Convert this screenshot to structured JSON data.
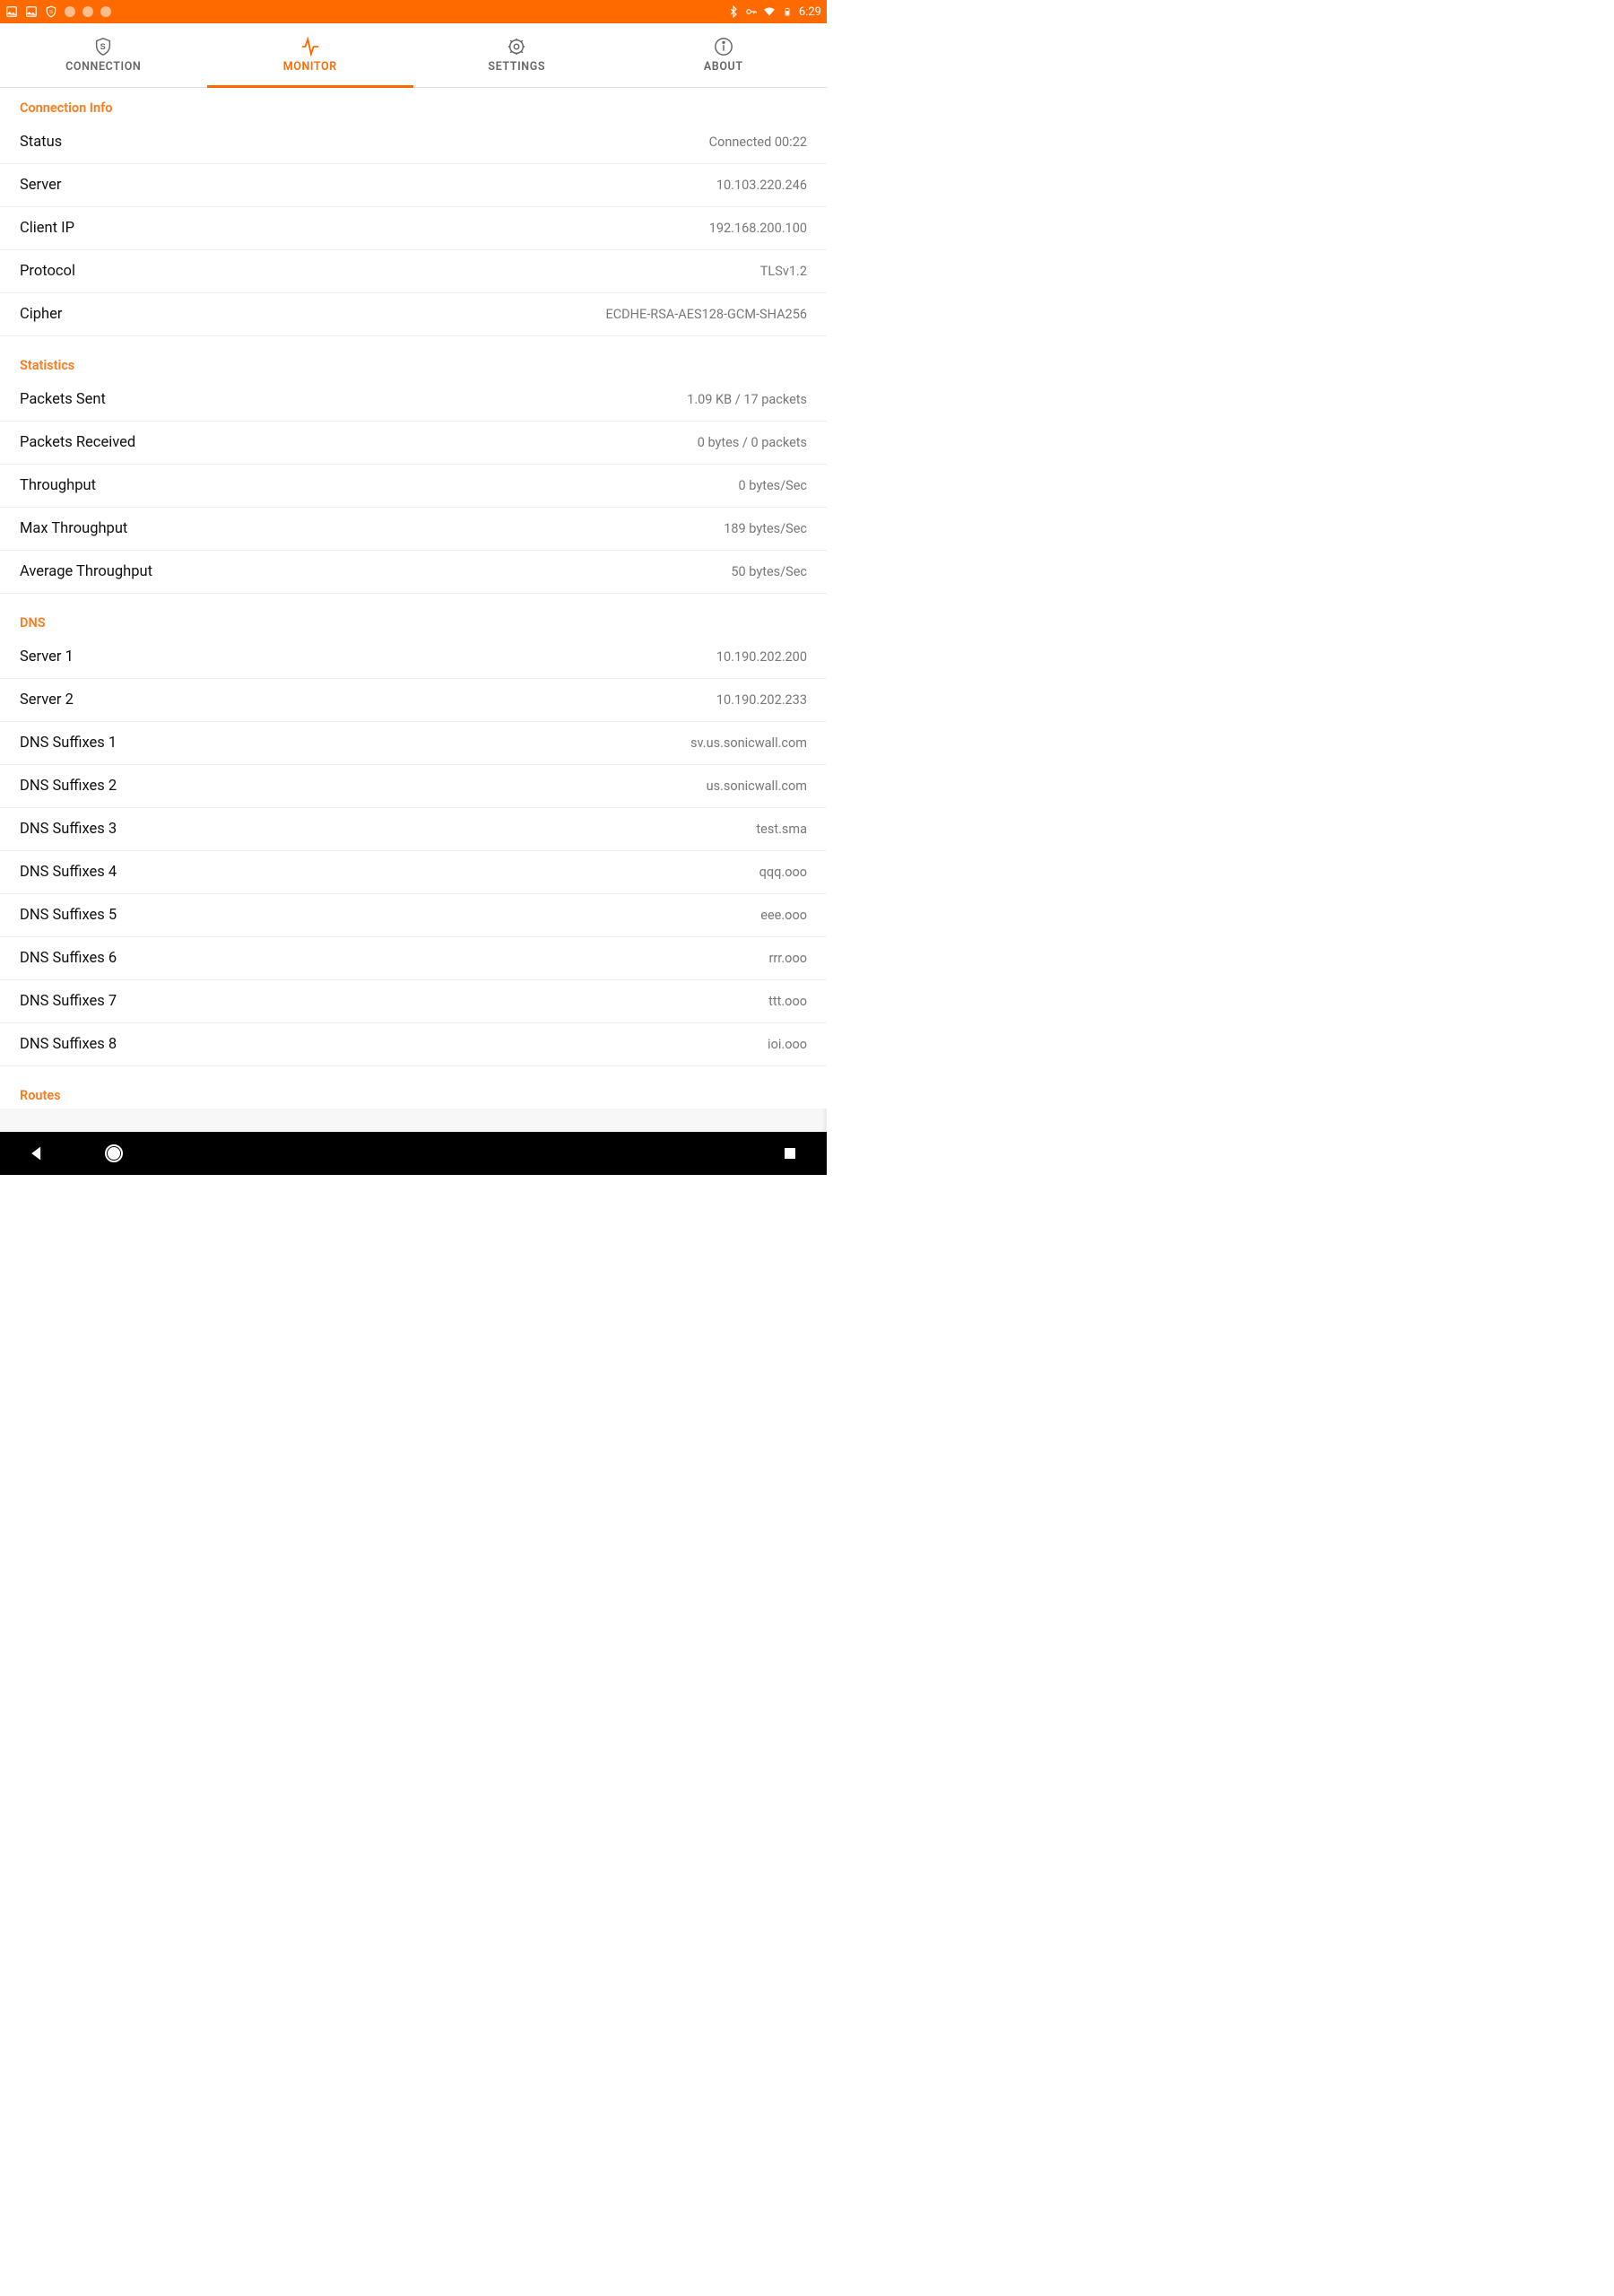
{
  "status_bar": {
    "time": "6:29"
  },
  "tabs": {
    "connection": "CONNECTION",
    "monitor": "MONITOR",
    "settings": "SETTINGS",
    "about": "ABOUT"
  },
  "sections": {
    "connection_info": {
      "title": "Connection Info",
      "status": {
        "label": "Status",
        "value": "Connected 00:22"
      },
      "server": {
        "label": "Server",
        "value": "10.103.220.246"
      },
      "client_ip": {
        "label": "Client IP",
        "value": "192.168.200.100"
      },
      "protocol": {
        "label": "Protocol",
        "value": "TLSv1.2"
      },
      "cipher": {
        "label": "Cipher",
        "value": "ECDHE-RSA-AES128-GCM-SHA256"
      }
    },
    "statistics": {
      "title": "Statistics",
      "packets_sent": {
        "label": "Packets Sent",
        "value": "1.09 KB / 17  packets"
      },
      "packets_received": {
        "label": "Packets Received",
        "value": "0  bytes / 0  packets"
      },
      "throughput": {
        "label": "Throughput",
        "value": "0  bytes/Sec"
      },
      "max_throughput": {
        "label": "Max Throughput",
        "value": "189  bytes/Sec"
      },
      "avg_throughput": {
        "label": "Average Throughput",
        "value": "50  bytes/Sec"
      }
    },
    "dns": {
      "title": "DNS",
      "server1": {
        "label": "Server 1",
        "value": "10.190.202.200"
      },
      "server2": {
        "label": "Server 2",
        "value": "10.190.202.233"
      },
      "suffix1": {
        "label": "DNS Suffixes 1",
        "value": "sv.us.sonicwall.com"
      },
      "suffix2": {
        "label": "DNS Suffixes 2",
        "value": "us.sonicwall.com"
      },
      "suffix3": {
        "label": "DNS Suffixes 3",
        "value": "test.sma"
      },
      "suffix4": {
        "label": "DNS Suffixes 4",
        "value": "qqq.ooo"
      },
      "suffix5": {
        "label": "DNS Suffixes 5",
        "value": "eee.ooo"
      },
      "suffix6": {
        "label": "DNS Suffixes 6",
        "value": "rrr.ooo"
      },
      "suffix7": {
        "label": "DNS Suffixes 7",
        "value": "ttt.ooo"
      },
      "suffix8": {
        "label": "DNS Suffixes 8",
        "value": "ioi.ooo"
      }
    },
    "routes": {
      "title": "Routes"
    }
  }
}
